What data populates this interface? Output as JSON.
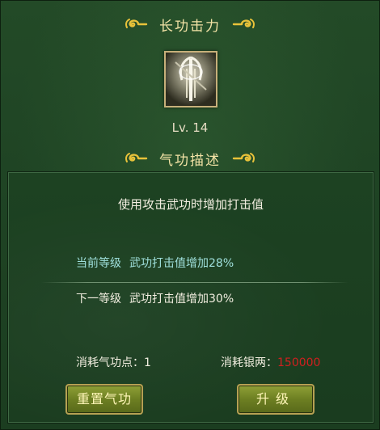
{
  "skill": {
    "name": "长功击力",
    "level_label": "Lv. 14",
    "icon_name": "staff-skill-icon"
  },
  "description_section": {
    "title": "气功描述",
    "text": "使用攻击武功时增加打击值",
    "current_level_label": "当前等级",
    "current_level_effect": "武功打击值增加28%",
    "next_level_label": "下一等级",
    "next_level_effect": "武功打击值增加30%"
  },
  "cost": {
    "points_label": "消耗气功点：",
    "points_value": "1",
    "silver_label": "消耗银两：",
    "silver_value": "150000"
  },
  "buttons": {
    "reset_label": "重置气功",
    "upgrade_label": "升级"
  },
  "colors": {
    "title": "#f3e3a6",
    "current_level": "#9fe0dc",
    "silver_value": "#d21f1f",
    "button_text": "#fff6b8"
  }
}
